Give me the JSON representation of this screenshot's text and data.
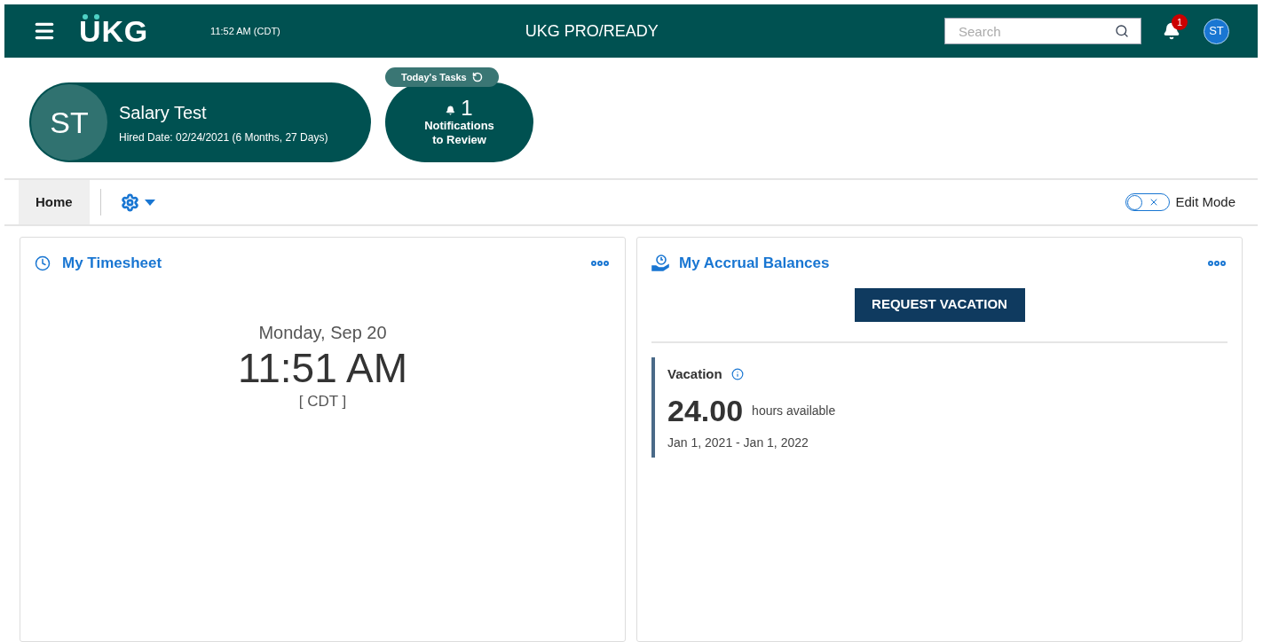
{
  "header": {
    "logo": "UKG",
    "time": "11:52 AM (CDT)",
    "title": "UKG PRO/READY",
    "search": {
      "placeholder": "Search"
    },
    "notification_count": "1",
    "avatar": "ST"
  },
  "profile": {
    "initials": "ST",
    "name": "Salary Test",
    "hired": "Hired Date: 02/24/2021 (6 Months, 27 Days)"
  },
  "tasks": {
    "label": "Today's Tasks",
    "count": "1",
    "text": "Notifications to Review"
  },
  "tabs": [
    {
      "label": "Home",
      "selected": true
    }
  ],
  "edit_mode": {
    "label": "Edit Mode",
    "on": false
  },
  "timesheet": {
    "title": "My Timesheet",
    "date": "Monday, Sep 20",
    "time": "11:51 AM",
    "zone": "[ CDT ]"
  },
  "accruals": {
    "title": "My Accrual Balances",
    "button": "REQUEST VACATION",
    "items": [
      {
        "name": "Vacation",
        "value": "24.00",
        "unit": "hours available",
        "period": "Jan 1, 2021 - Jan 1, 2022"
      }
    ]
  }
}
